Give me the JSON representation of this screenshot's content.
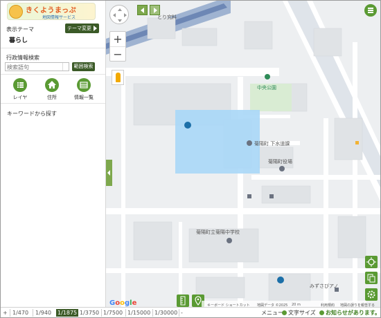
{
  "panel": {
    "logo_title": "きくようまっぷ",
    "logo_sub": "地図情報サービス",
    "theme_label": "表示テーマ",
    "theme_value": "暮らし",
    "theme_change_label": "テーマ変更",
    "admin_search_label": "行政情報検索",
    "search_placeholder": "検索語句",
    "range_search_label": "範囲検索",
    "tools": [
      {
        "label": "レイヤ",
        "icon": "list-icon"
      },
      {
        "label": "住所",
        "icon": "home-icon"
      },
      {
        "label": "情報一覧",
        "icon": "table-icon"
      }
    ],
    "keyword_label": "キーワードから探す"
  },
  "map": {
    "labels": {
      "park": "中央公園",
      "sewer": "菊陽町 下水道課",
      "town_office": "菊陽町役場",
      "school": "菊陽町立菊陽中学校",
      "shop": "みずさびアノ",
      "corner": "とり究料"
    },
    "attribution": {
      "shortcuts": "キーボード ショートカット",
      "data": "地図データ ©2025",
      "scale": "20 m",
      "terms": "利用規約",
      "report": "地図の誤りを報告する"
    },
    "google": "Google",
    "highlight_color": "#a9d7f7"
  },
  "bottom_bar": {
    "scales": [
      "1/470",
      "1/940",
      "1/1875",
      "1/3750",
      "1/7500",
      "1/15000",
      "1/30000"
    ],
    "selected_scale": "1/1875",
    "menu": "メニュー",
    "text_size": "文字サイズ",
    "notice": "お知らせがあります。"
  }
}
